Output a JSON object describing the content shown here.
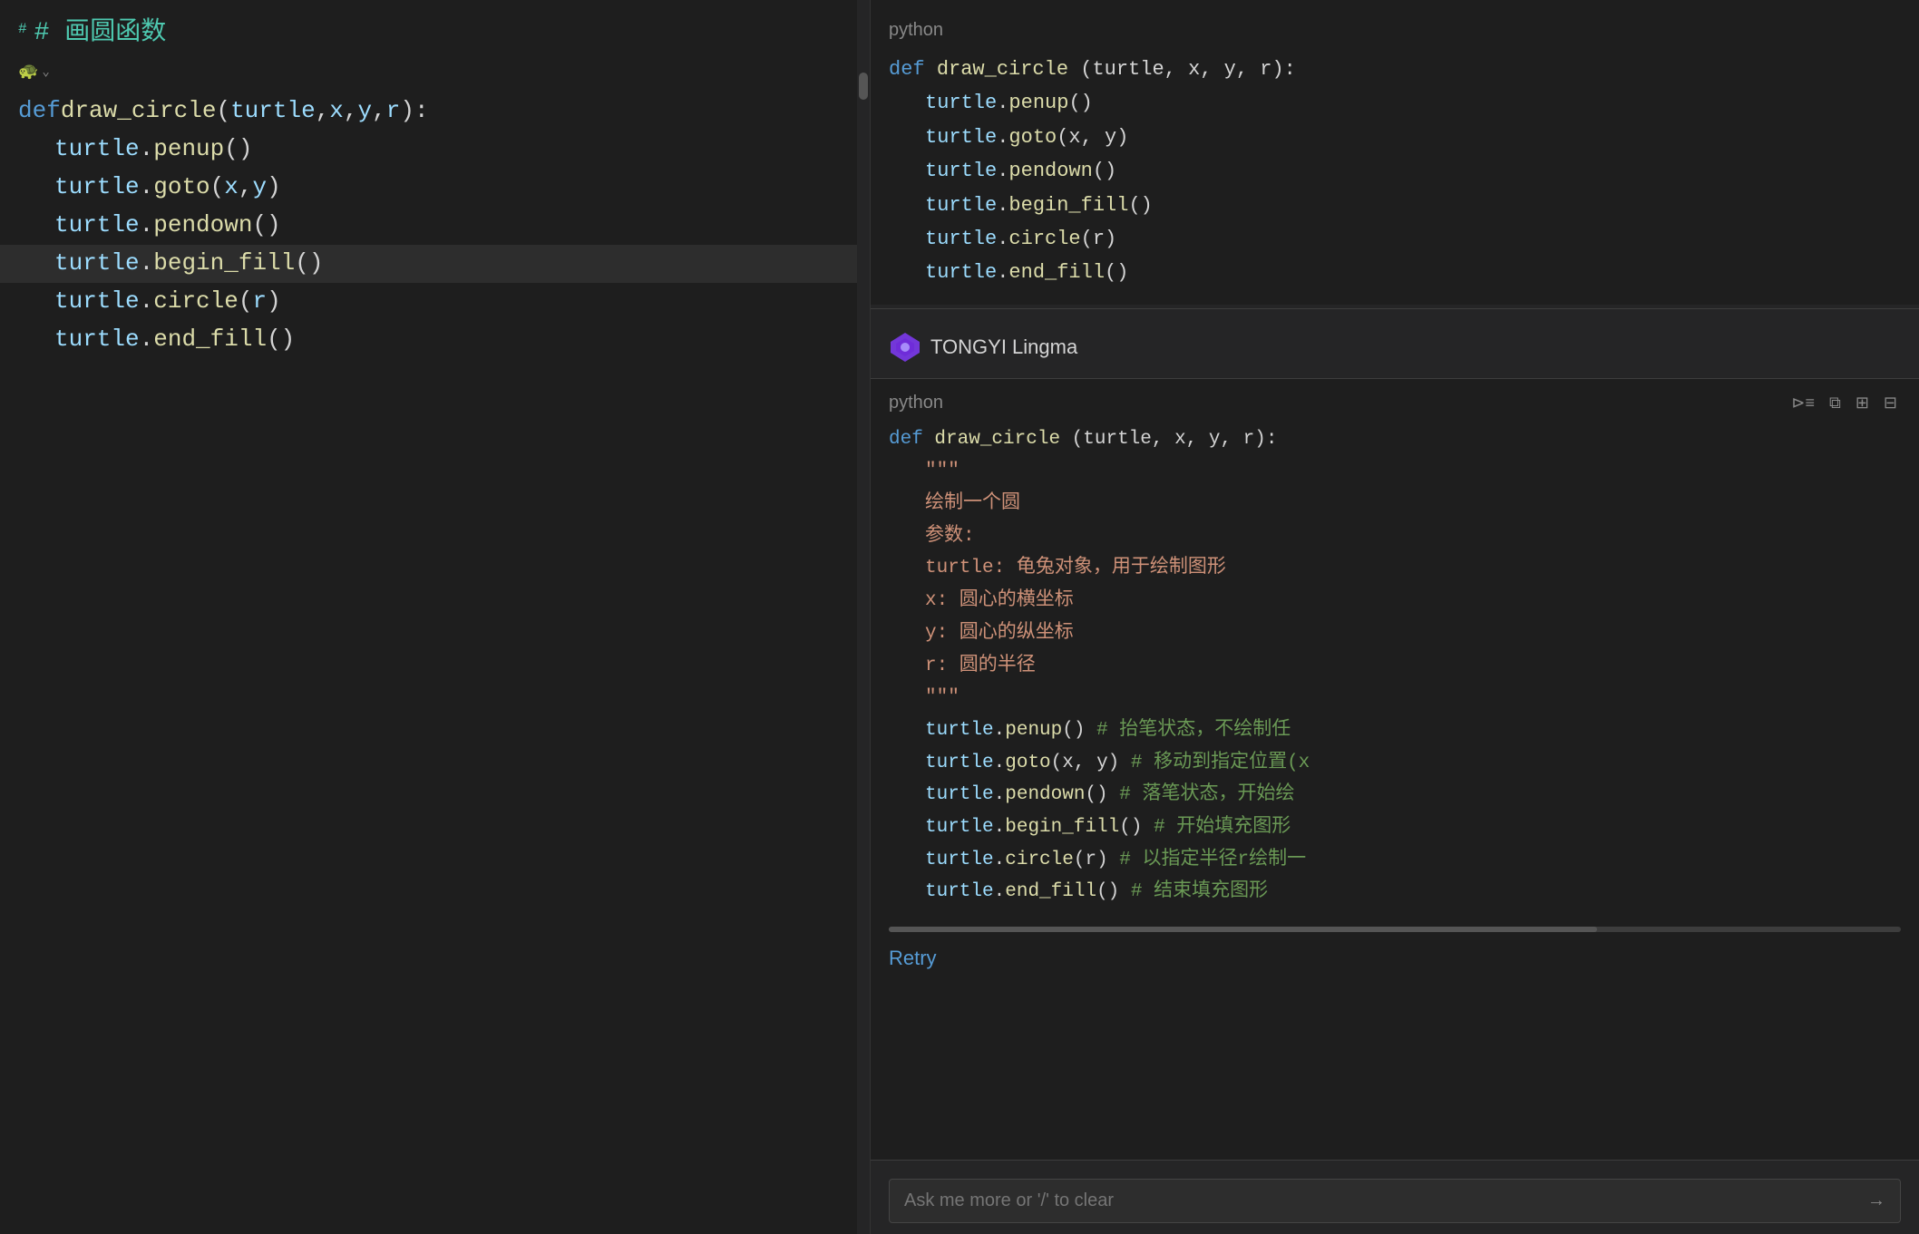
{
  "editor": {
    "title": "# 画圆函数",
    "breadcrumb": {
      "icon": "🐢",
      "dropdown_arrow": "⌄"
    },
    "code_lines": [
      {
        "id": 1,
        "content": "def_draw_circle",
        "highlighted": false
      },
      {
        "id": 2,
        "content": "turtle.penup()",
        "highlighted": false
      },
      {
        "id": 3,
        "content": "turtle.goto(x, y)",
        "highlighted": false
      },
      {
        "id": 4,
        "content": "turtle.pendown()",
        "highlighted": false
      },
      {
        "id": 5,
        "content": "turtle.begin_fill()",
        "highlighted": true
      },
      {
        "id": 6,
        "content": "turtle.circle(r)",
        "highlighted": false
      },
      {
        "id": 7,
        "content": "turtle.end_fill()",
        "highlighted": false
      }
    ]
  },
  "ai_panel": {
    "top_code": {
      "lang": "python",
      "lines": [
        "def draw_circle(turtle, x, y, r):",
        "    turtle.penup()",
        "    turtle.goto(x, y)",
        "    turtle.pendown()",
        "    turtle.begin_fill()",
        "    turtle.circle(r)",
        "    turtle.end_fill()"
      ]
    },
    "header": {
      "logo_alt": "TONGYI Lingma logo",
      "title": "TONGYI Lingma"
    },
    "response_code": {
      "lang": "python",
      "actions": {
        "run": "⊳",
        "copy": "⧉",
        "add": "+",
        "file": "⊟"
      },
      "lines": [
        {
          "text": "def draw_circle(turtle, x, y, r):",
          "type": "def"
        },
        {
          "text": "    \"\"\"",
          "type": "docstring"
        },
        {
          "text": "    绘制一个圆",
          "type": "docstring"
        },
        {
          "text": "    参数:",
          "type": "docstring"
        },
        {
          "text": "    turtle: 龟兔对象，用于绘制图形",
          "type": "docstring"
        },
        {
          "text": "    x: 圆心的横坐标",
          "type": "docstring"
        },
        {
          "text": "    y: 圆心的纵坐标",
          "type": "docstring"
        },
        {
          "text": "    r: 圆的半径",
          "type": "docstring"
        },
        {
          "text": "    \"\"\"",
          "type": "docstring"
        },
        {
          "text": "    turtle.penup()   # 抬笔状态，不绘制任",
          "type": "with_comment"
        },
        {
          "text": "    turtle.goto(x, y)  # 移动到指定位置(x",
          "type": "with_comment"
        },
        {
          "text": "    turtle.pendown()  # 落笔状态，开始绘",
          "type": "with_comment"
        },
        {
          "text": "    turtle.begin_fill()  # 开始填充图形",
          "type": "with_comment"
        },
        {
          "text": "    turtle.circle(r)  # 以指定半径r绘制一",
          "type": "with_comment"
        },
        {
          "text": "    turtle.end_fill()  # 结束填充图形",
          "type": "with_comment"
        }
      ]
    },
    "retry_label": "Retry",
    "input_placeholder": "Ask me more or '/' to clear",
    "send_arrow": "→"
  }
}
